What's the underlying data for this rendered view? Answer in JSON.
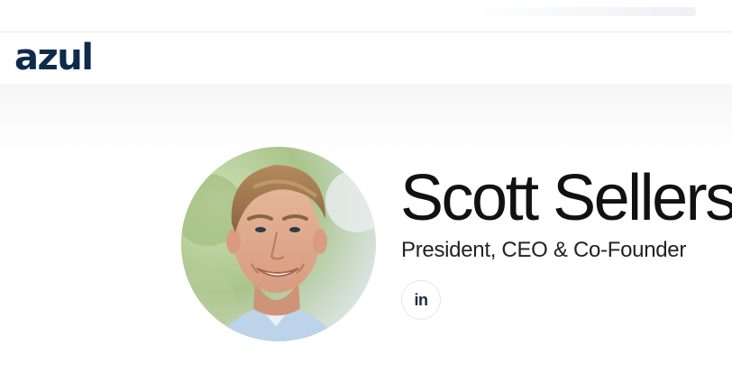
{
  "header": {
    "logo_text": "azul"
  },
  "profile": {
    "name": "Scott Sellers",
    "title": "President, CEO & Co-Founder",
    "photo_alt": "Scott Sellers"
  },
  "social": {
    "linkedin_label": "in"
  },
  "colors": {
    "brand": "#0f2a4a",
    "text": "#111111"
  },
  "icons": {
    "linkedin": "linkedin-icon"
  }
}
